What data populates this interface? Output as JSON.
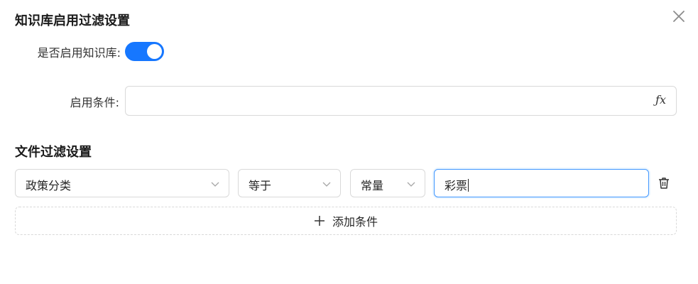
{
  "dialog": {
    "title": "知识库启用过滤设置",
    "close_icon": "close-icon"
  },
  "kb_enable": {
    "label": "是否启用知识库:",
    "enabled": true,
    "accent_color": "#1677ff"
  },
  "enable_condition": {
    "label": "启用条件:",
    "value": "",
    "fx_label": "ƒx"
  },
  "file_filter": {
    "title": "文件过滤设置",
    "condition": {
      "field": "政策分类",
      "operator": "等于",
      "value_type": "常量",
      "value": "彩票"
    },
    "delete_icon": "trash-icon",
    "add_label": "添加条件",
    "add_icon": "plus-icon"
  }
}
